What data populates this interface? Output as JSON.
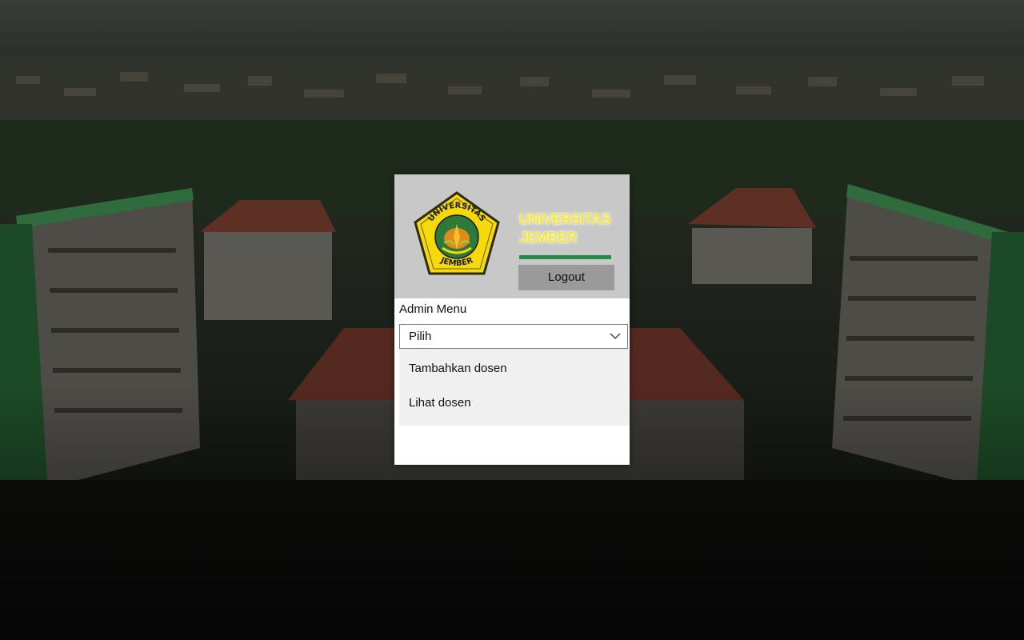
{
  "header": {
    "brand_line1": "UNIVERSITAS",
    "brand_line2": "JEMBER",
    "logout_label": "Logout",
    "logo_text_top": "UNIVERSITAS",
    "logo_text_bottom": "JEMBER"
  },
  "menu": {
    "label": "Admin Menu",
    "selected": "Pilih",
    "options": [
      "Tambahkan dosen",
      "Lihat dosen"
    ]
  },
  "colors": {
    "brand_text": "#f4e63a",
    "brand_bar": "#1f8a4a",
    "header_bg": "#c8c8c8",
    "logout_bg": "#9a9a9a",
    "dropdown_bg": "#f0f0f0"
  },
  "icons": {
    "select_toggle": "chevron-down-icon",
    "logo": "university-emblem-icon"
  }
}
